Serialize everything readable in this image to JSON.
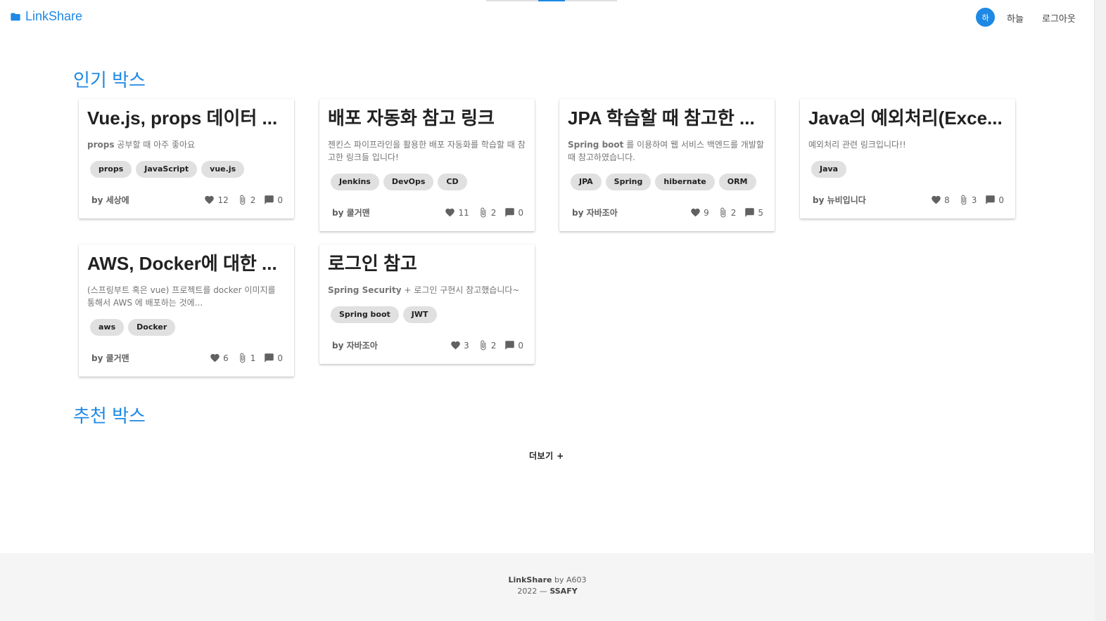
{
  "header": {
    "logo_text": "LinkShare",
    "avatar_initial": "하",
    "user_name": "하늘",
    "logout_label": "로그아웃"
  },
  "colors": {
    "accent": "#1e88e5",
    "tag_bg": "#e0e0e0",
    "footer_bg": "#f5f5f5"
  },
  "popular": {
    "title": "인기 박스",
    "cards": [
      {
        "title": "Vue.js, props 데이터 ...",
        "desc_bold": "props",
        "desc_rest": " 공부할 때 아주 좋아요",
        "tags": [
          "props",
          "JavaScript",
          "vue.js"
        ],
        "author": "by 세상에",
        "likes": "12",
        "links": "2",
        "comments": "0"
      },
      {
        "title": "배포 자동화 참고 링크",
        "desc_bold": "",
        "desc_rest": "젠킨스 파이프라인을 활용한 배포 자동화를 학습할 때 참고한 링크들 입니다!",
        "tags": [
          "Jenkins",
          "DevOps",
          "CD"
        ],
        "author": "by 쿨거맨",
        "likes": "11",
        "links": "2",
        "comments": "0"
      },
      {
        "title": "JPA 학습할 때 참고한 ...",
        "desc_bold": "Spring boot",
        "desc_rest": " 를 이용하여 웹 서비스 백엔드를 개발할 때 참고하였습니다.",
        "tags": [
          "JPA",
          "Spring",
          "hibernate",
          "ORM"
        ],
        "author": "by 자바조아",
        "likes": "9",
        "links": "2",
        "comments": "5"
      },
      {
        "title": "Java의 예외처리(Exce...",
        "desc_bold": "",
        "desc_rest": "예외처리 관련 링크입니다!!",
        "tags": [
          "Java"
        ],
        "author": "by 뉴비입니다",
        "likes": "8",
        "links": "3",
        "comments": "0"
      },
      {
        "title": "AWS, Docker에 대한 ...",
        "desc_bold": "",
        "desc_rest": "(스프링부트 혹은 vue) 프로젝트를 docker 이미지를 통해서 AWS 에 배포하는 것에...",
        "tags": [
          "aws",
          "Docker"
        ],
        "author": "by 쿨거맨",
        "likes": "6",
        "links": "1",
        "comments": "0"
      },
      {
        "title": "로그인 참고",
        "desc_bold": "Spring Security",
        "desc_rest": " + 로그인 구현시 참고했습니다~",
        "tags": [
          "Spring boot",
          "JWT"
        ],
        "author": "by 자바조아",
        "likes": "3",
        "links": "2",
        "comments": "0"
      }
    ]
  },
  "recommended": {
    "title": "추천 박스"
  },
  "more_label": "더보기 +",
  "footer": {
    "brand": "LinkShare",
    "by_text": " by A603",
    "year": "2022 — ",
    "org": "SSAFY"
  }
}
